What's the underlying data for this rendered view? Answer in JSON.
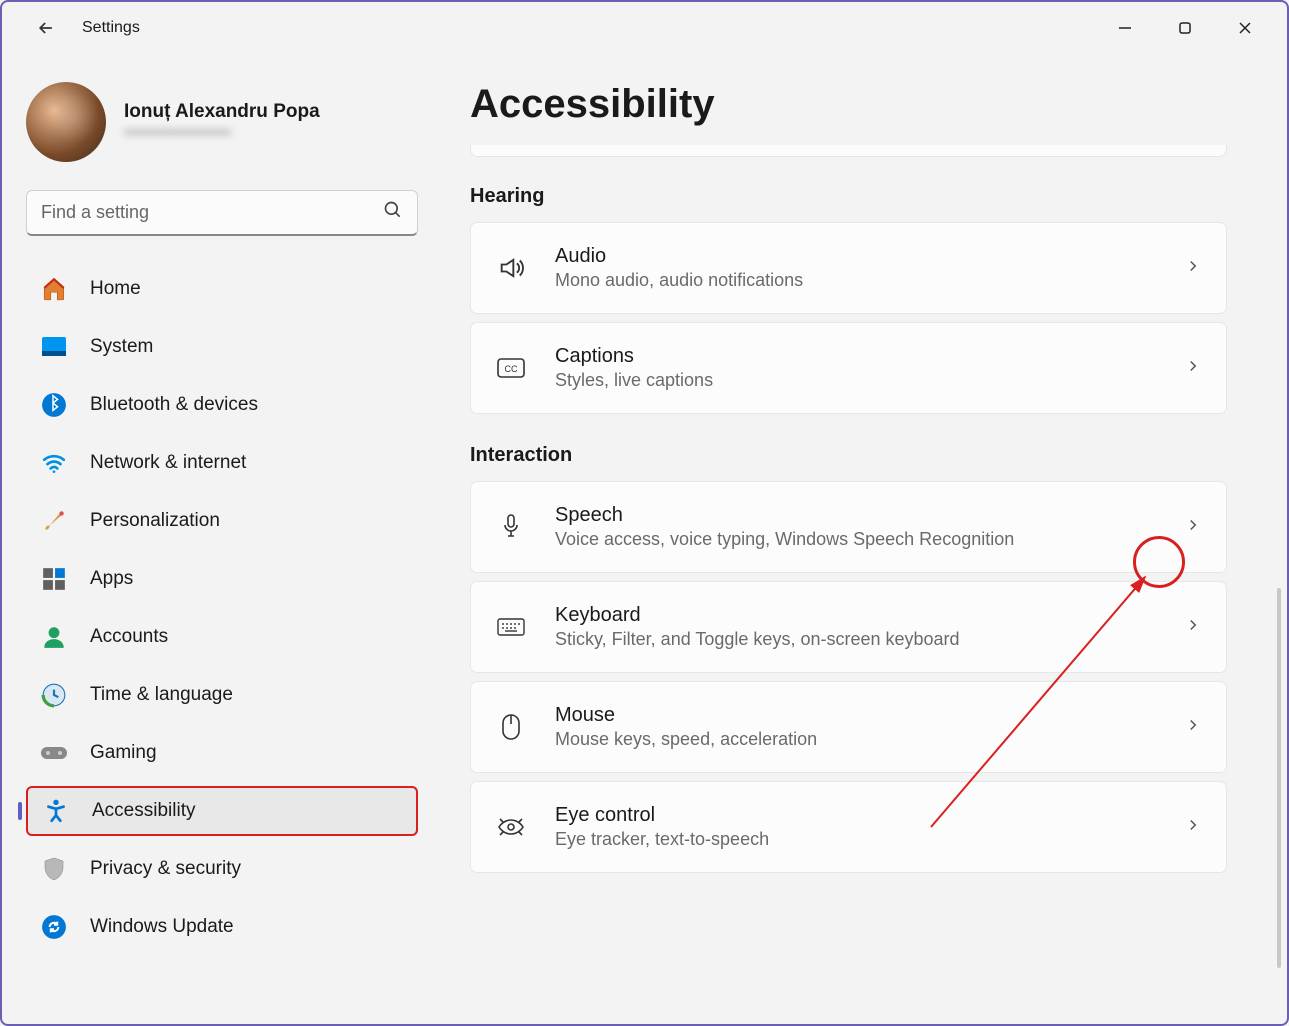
{
  "window": {
    "title": "Settings"
  },
  "profile": {
    "name": "Ionuț Alexandru Popa",
    "email_masked": "••••••••••••••••••"
  },
  "search": {
    "placeholder": "Find a setting"
  },
  "nav": [
    {
      "id": "home",
      "label": "Home"
    },
    {
      "id": "system",
      "label": "System"
    },
    {
      "id": "bluetooth",
      "label": "Bluetooth & devices"
    },
    {
      "id": "network",
      "label": "Network & internet"
    },
    {
      "id": "personalization",
      "label": "Personalization"
    },
    {
      "id": "apps",
      "label": "Apps"
    },
    {
      "id": "accounts",
      "label": "Accounts"
    },
    {
      "id": "time",
      "label": "Time & language"
    },
    {
      "id": "gaming",
      "label": "Gaming"
    },
    {
      "id": "accessibility",
      "label": "Accessibility",
      "active": true
    },
    {
      "id": "privacy",
      "label": "Privacy & security"
    },
    {
      "id": "update",
      "label": "Windows Update"
    }
  ],
  "page": {
    "title": "Accessibility",
    "sections": [
      {
        "heading": "Hearing",
        "items": [
          {
            "id": "audio",
            "title": "Audio",
            "desc": "Mono audio, audio notifications"
          },
          {
            "id": "captions",
            "title": "Captions",
            "desc": "Styles, live captions"
          }
        ]
      },
      {
        "heading": "Interaction",
        "items": [
          {
            "id": "speech",
            "title": "Speech",
            "desc": "Voice access, voice typing, Windows Speech Recognition"
          },
          {
            "id": "keyboard",
            "title": "Keyboard",
            "desc": "Sticky, Filter, and Toggle keys, on-screen keyboard"
          },
          {
            "id": "mouse",
            "title": "Mouse",
            "desc": "Mouse keys, speed, acceleration"
          },
          {
            "id": "eye",
            "title": "Eye control",
            "desc": "Eye tracker, text-to-speech"
          }
        ]
      }
    ]
  }
}
